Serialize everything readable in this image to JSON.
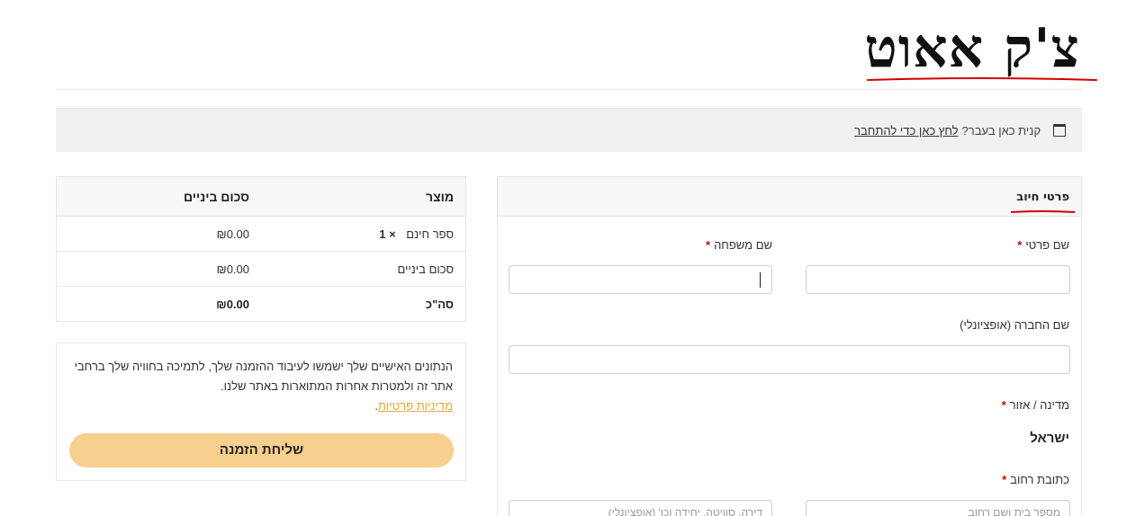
{
  "header": {
    "title": "צ'ק אאוט"
  },
  "login_notice": {
    "text": "קנית כאן בעבר?",
    "link": "לחץ כאן כדי להתחבר"
  },
  "order": {
    "headers": [
      "מוצר",
      "סכום ביניים"
    ],
    "item": {
      "name": "ספר חינם",
      "qty": "× 1",
      "total": "₪0.00"
    },
    "subtotal": {
      "label": "סכום ביניים",
      "value": "₪0.00"
    },
    "total": {
      "label": "סה\"כ",
      "value": "₪0.00"
    }
  },
  "privacy": {
    "text": "הנתונים האישיים שלך ישמשו לעיבוד ההזמנה שלך, לתמיכה בחוויה שלך ברחבי אתר זה ולמטרות אחרות המתוארות באתר שלנו.",
    "link": "מדיניות פרטיות",
    "button": "שליחת הזמנה"
  },
  "billing": {
    "title": "פרטי חיוב",
    "first_name_label": "שם פרטי",
    "last_name_label": "שם משפחה",
    "company_label": "שם החברה (אופציונלי)",
    "country_label": "מדינה / אזור",
    "country_value": "ישראל",
    "street_label": "כתובת רחוב",
    "street_placeholder": "מספר בית ושם רחוב",
    "apt_placeholder": "דירה, סוויטה, יחידה וכו' (אופציונלי)",
    "required_mark": "*"
  },
  "colors": {
    "accent": "#f7cf8e",
    "underline": "#d20000",
    "link": "#e6a832"
  }
}
